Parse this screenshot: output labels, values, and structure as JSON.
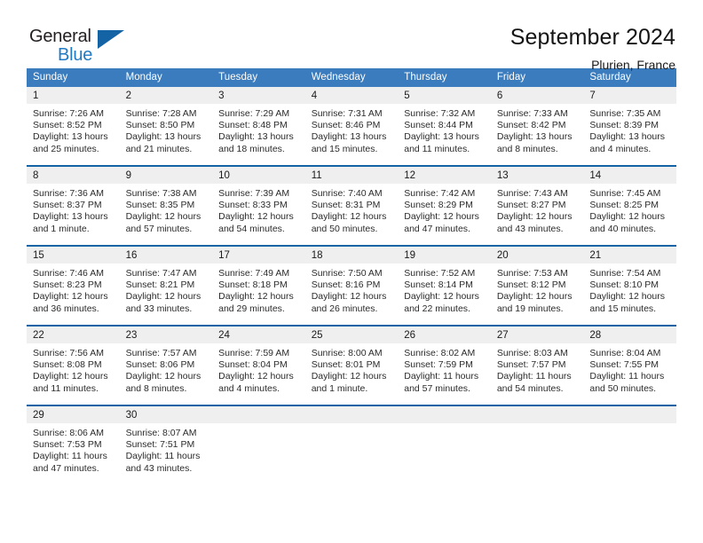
{
  "brand": {
    "word_general": "General",
    "word_blue": "Blue",
    "flag_icon": "triangle-flag-icon",
    "accent_color": "#1f7ac4"
  },
  "header": {
    "title": "September 2024",
    "subtitle": "Plurien, France"
  },
  "theme": {
    "header_row_bg": "#3a7cbe",
    "week_divider": "#1464a5",
    "daynum_bg": "#efefef"
  },
  "calendar": {
    "weekday_headers": [
      "Sunday",
      "Monday",
      "Tuesday",
      "Wednesday",
      "Thursday",
      "Friday",
      "Saturday"
    ],
    "weeks": [
      [
        {
          "day": "1",
          "sunrise": "Sunrise: 7:26 AM",
          "sunset": "Sunset: 8:52 PM",
          "daylight": "Daylight: 13 hours and 25 minutes."
        },
        {
          "day": "2",
          "sunrise": "Sunrise: 7:28 AM",
          "sunset": "Sunset: 8:50 PM",
          "daylight": "Daylight: 13 hours and 21 minutes."
        },
        {
          "day": "3",
          "sunrise": "Sunrise: 7:29 AM",
          "sunset": "Sunset: 8:48 PM",
          "daylight": "Daylight: 13 hours and 18 minutes."
        },
        {
          "day": "4",
          "sunrise": "Sunrise: 7:31 AM",
          "sunset": "Sunset: 8:46 PM",
          "daylight": "Daylight: 13 hours and 15 minutes."
        },
        {
          "day": "5",
          "sunrise": "Sunrise: 7:32 AM",
          "sunset": "Sunset: 8:44 PM",
          "daylight": "Daylight: 13 hours and 11 minutes."
        },
        {
          "day": "6",
          "sunrise": "Sunrise: 7:33 AM",
          "sunset": "Sunset: 8:42 PM",
          "daylight": "Daylight: 13 hours and 8 minutes."
        },
        {
          "day": "7",
          "sunrise": "Sunrise: 7:35 AM",
          "sunset": "Sunset: 8:39 PM",
          "daylight": "Daylight: 13 hours and 4 minutes."
        }
      ],
      [
        {
          "day": "8",
          "sunrise": "Sunrise: 7:36 AM",
          "sunset": "Sunset: 8:37 PM",
          "daylight": "Daylight: 13 hours and 1 minute."
        },
        {
          "day": "9",
          "sunrise": "Sunrise: 7:38 AM",
          "sunset": "Sunset: 8:35 PM",
          "daylight": "Daylight: 12 hours and 57 minutes."
        },
        {
          "day": "10",
          "sunrise": "Sunrise: 7:39 AM",
          "sunset": "Sunset: 8:33 PM",
          "daylight": "Daylight: 12 hours and 54 minutes."
        },
        {
          "day": "11",
          "sunrise": "Sunrise: 7:40 AM",
          "sunset": "Sunset: 8:31 PM",
          "daylight": "Daylight: 12 hours and 50 minutes."
        },
        {
          "day": "12",
          "sunrise": "Sunrise: 7:42 AM",
          "sunset": "Sunset: 8:29 PM",
          "daylight": "Daylight: 12 hours and 47 minutes."
        },
        {
          "day": "13",
          "sunrise": "Sunrise: 7:43 AM",
          "sunset": "Sunset: 8:27 PM",
          "daylight": "Daylight: 12 hours and 43 minutes."
        },
        {
          "day": "14",
          "sunrise": "Sunrise: 7:45 AM",
          "sunset": "Sunset: 8:25 PM",
          "daylight": "Daylight: 12 hours and 40 minutes."
        }
      ],
      [
        {
          "day": "15",
          "sunrise": "Sunrise: 7:46 AM",
          "sunset": "Sunset: 8:23 PM",
          "daylight": "Daylight: 12 hours and 36 minutes."
        },
        {
          "day": "16",
          "sunrise": "Sunrise: 7:47 AM",
          "sunset": "Sunset: 8:21 PM",
          "daylight": "Daylight: 12 hours and 33 minutes."
        },
        {
          "day": "17",
          "sunrise": "Sunrise: 7:49 AM",
          "sunset": "Sunset: 8:18 PM",
          "daylight": "Daylight: 12 hours and 29 minutes."
        },
        {
          "day": "18",
          "sunrise": "Sunrise: 7:50 AM",
          "sunset": "Sunset: 8:16 PM",
          "daylight": "Daylight: 12 hours and 26 minutes."
        },
        {
          "day": "19",
          "sunrise": "Sunrise: 7:52 AM",
          "sunset": "Sunset: 8:14 PM",
          "daylight": "Daylight: 12 hours and 22 minutes."
        },
        {
          "day": "20",
          "sunrise": "Sunrise: 7:53 AM",
          "sunset": "Sunset: 8:12 PM",
          "daylight": "Daylight: 12 hours and 19 minutes."
        },
        {
          "day": "21",
          "sunrise": "Sunrise: 7:54 AM",
          "sunset": "Sunset: 8:10 PM",
          "daylight": "Daylight: 12 hours and 15 minutes."
        }
      ],
      [
        {
          "day": "22",
          "sunrise": "Sunrise: 7:56 AM",
          "sunset": "Sunset: 8:08 PM",
          "daylight": "Daylight: 12 hours and 11 minutes."
        },
        {
          "day": "23",
          "sunrise": "Sunrise: 7:57 AM",
          "sunset": "Sunset: 8:06 PM",
          "daylight": "Daylight: 12 hours and 8 minutes."
        },
        {
          "day": "24",
          "sunrise": "Sunrise: 7:59 AM",
          "sunset": "Sunset: 8:04 PM",
          "daylight": "Daylight: 12 hours and 4 minutes."
        },
        {
          "day": "25",
          "sunrise": "Sunrise: 8:00 AM",
          "sunset": "Sunset: 8:01 PM",
          "daylight": "Daylight: 12 hours and 1 minute."
        },
        {
          "day": "26",
          "sunrise": "Sunrise: 8:02 AM",
          "sunset": "Sunset: 7:59 PM",
          "daylight": "Daylight: 11 hours and 57 minutes."
        },
        {
          "day": "27",
          "sunrise": "Sunrise: 8:03 AM",
          "sunset": "Sunset: 7:57 PM",
          "daylight": "Daylight: 11 hours and 54 minutes."
        },
        {
          "day": "28",
          "sunrise": "Sunrise: 8:04 AM",
          "sunset": "Sunset: 7:55 PM",
          "daylight": "Daylight: 11 hours and 50 minutes."
        }
      ],
      [
        {
          "day": "29",
          "sunrise": "Sunrise: 8:06 AM",
          "sunset": "Sunset: 7:53 PM",
          "daylight": "Daylight: 11 hours and 47 minutes."
        },
        {
          "day": "30",
          "sunrise": "Sunrise: 8:07 AM",
          "sunset": "Sunset: 7:51 PM",
          "daylight": "Daylight: 11 hours and 43 minutes."
        },
        {
          "day": "",
          "sunrise": "",
          "sunset": "",
          "daylight": ""
        },
        {
          "day": "",
          "sunrise": "",
          "sunset": "",
          "daylight": ""
        },
        {
          "day": "",
          "sunrise": "",
          "sunset": "",
          "daylight": ""
        },
        {
          "day": "",
          "sunrise": "",
          "sunset": "",
          "daylight": ""
        },
        {
          "day": "",
          "sunrise": "",
          "sunset": "",
          "daylight": ""
        }
      ]
    ]
  }
}
